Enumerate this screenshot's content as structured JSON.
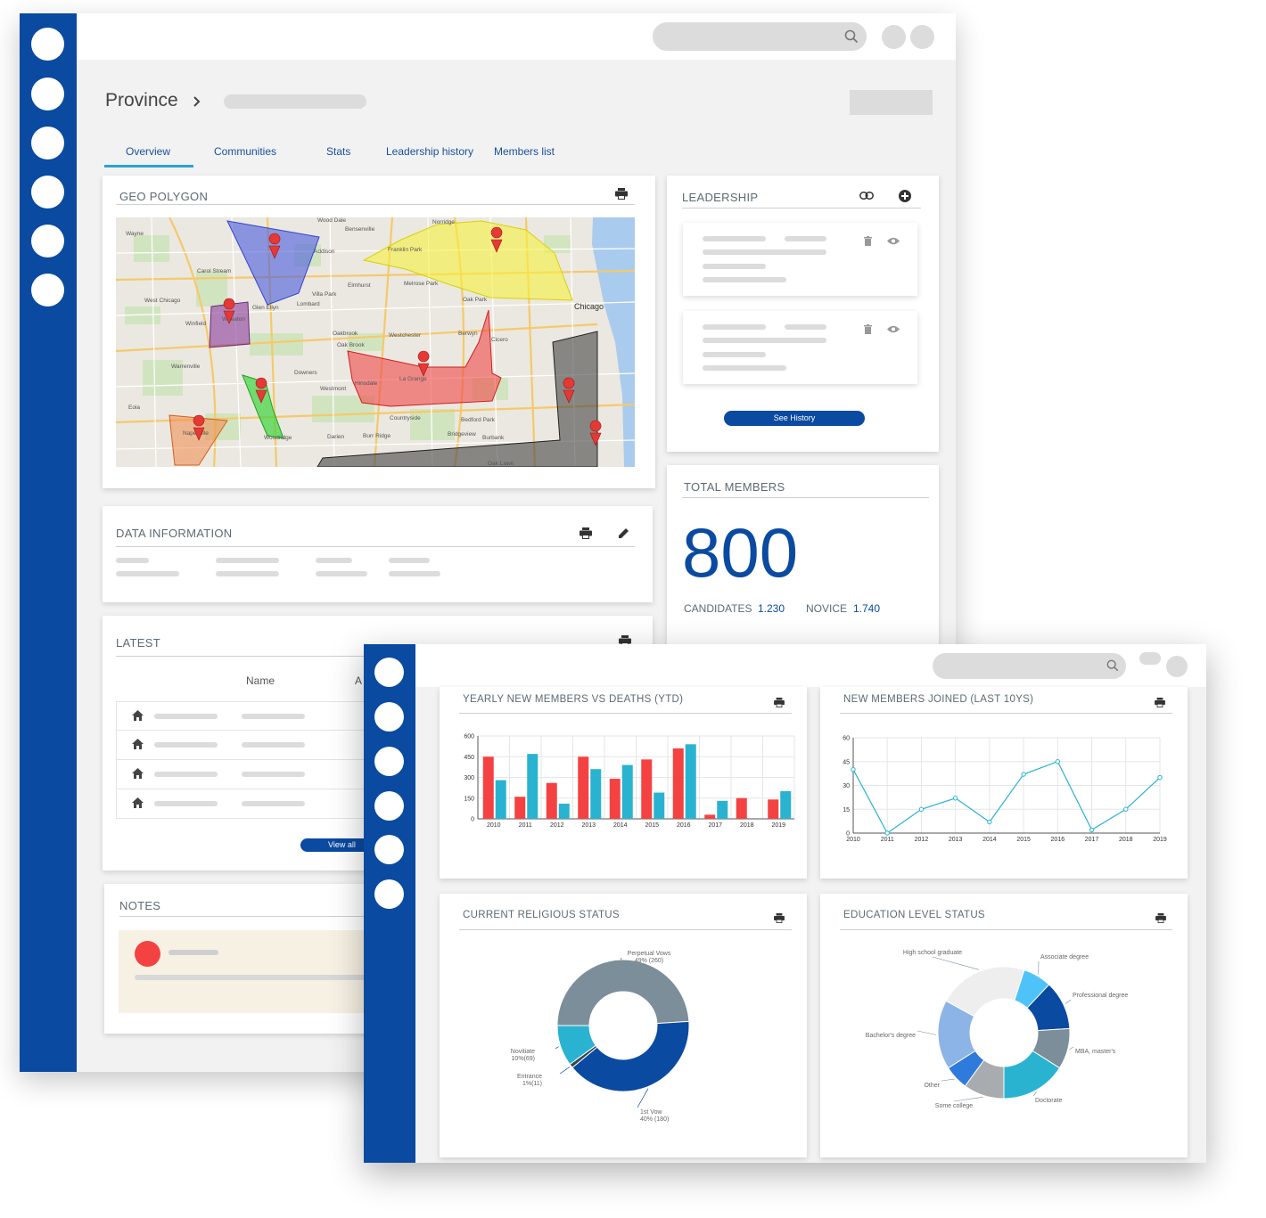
{
  "back_window": {
    "header": {
      "page_title": "Province"
    },
    "tabs": [
      "Overview",
      "Communities",
      "Stats",
      "Leadership history",
      "Members list"
    ],
    "geo_polygon": {
      "title": "GEO POLYGON",
      "map_labels": [
        "Wood Dale",
        "Bensenville",
        "Norridge",
        "Wayne",
        "Addison",
        "Franklin Park",
        "Carol Stream",
        "Elmhurst",
        "Melrose Park",
        "Villa Park",
        "Oak Park",
        "Chicago",
        "West Chicago",
        "Glen Ellyn",
        "Lombard",
        "Winfield",
        "Wheaton",
        "Oakbrook Terrace",
        "Oak Brook",
        "Westchester",
        "Berwyn",
        "Cicero",
        "Warrenville",
        "Downers Grove",
        "Hinsdale",
        "La Grange",
        "Westmont",
        "Eola",
        "Countryside",
        "Bedford Park",
        "Naperville",
        "Woodridge",
        "Darien",
        "Burr Ridge",
        "Bridgeview",
        "Burbank",
        "Oak Lawn"
      ]
    },
    "data_information": {
      "title": "DATA INFORMATION"
    },
    "latest": {
      "title": "LATEST",
      "column_name": "Name",
      "column_a": "A",
      "view_all": "View all"
    },
    "notes": {
      "title": "NOTES"
    },
    "leadership": {
      "title": "LEADERSHIP",
      "see_history": "See History"
    },
    "total_members": {
      "title": "TOTAL MEMBERS",
      "value": "800",
      "candidates_label": "CANDIDATES",
      "candidates_value": "1.230",
      "novice_label": "NOVICE",
      "novice_value": "1.740"
    }
  },
  "front_window": {
    "yearly_chart": {
      "title": "YEARLY NEW MEMBERS VS DEATHS (YTD)"
    },
    "joined_chart": {
      "title": "NEW MEMBERS JOINED (LAST 10YS)"
    },
    "religious_chart": {
      "title": "CURRENT RELIGIOUS STATUS"
    },
    "education_chart": {
      "title": "EDUCATION LEVEL STATUS"
    }
  },
  "colors": {
    "brand_blue": "#0a4aa1",
    "red": "#f44242",
    "teal": "#29b3d1",
    "slate": "#7b8e99"
  },
  "chart_data": [
    {
      "type": "bar",
      "title": "YEARLY NEW MEMBERS VS DEATHS (YTD)",
      "categories": [
        "2010",
        "2011",
        "2012",
        "2013",
        "2014",
        "2015",
        "2016",
        "2017",
        "2018",
        "2019"
      ],
      "ylim": [
        0,
        600
      ],
      "yticks": [
        0,
        150,
        300,
        450,
        600
      ],
      "series": [
        {
          "values": [
            450,
            160,
            260,
            450,
            290,
            430,
            510,
            30,
            150,
            140
          ]
        },
        {
          "values": [
            280,
            470,
            110,
            360,
            390,
            190,
            540,
            130,
            0,
            200
          ]
        }
      ]
    },
    {
      "type": "line",
      "title": "NEW MEMBERS JOINED (LAST 10YS)",
      "categories": [
        "2010",
        "2011",
        "2012",
        "2013",
        "2014",
        "2015",
        "2016",
        "2017",
        "2018",
        "2019"
      ],
      "ylim": [
        0,
        60
      ],
      "yticks": [
        0,
        15,
        30,
        45,
        60
      ],
      "values": [
        40,
        0,
        15,
        22,
        7,
        37,
        45,
        2,
        15,
        35
      ]
    },
    {
      "type": "pie",
      "title": "CURRENT RELIGIOUS STATUS",
      "slices": [
        {
          "label": "Perpetual Vows",
          "value_text": "49% (260)",
          "value": 49
        },
        {
          "label": "1st Vow",
          "value_text": "40% (180)",
          "value": 40
        },
        {
          "label": "Entrance",
          "value_text": "1%(11)",
          "value": 1
        },
        {
          "label": "Novitiate",
          "value_text": "10%(69)",
          "value": 10
        }
      ]
    },
    {
      "type": "pie",
      "title": "EDUCATION LEVEL STATUS",
      "slices": [
        {
          "label": "Associate degree",
          "value": 7
        },
        {
          "label": "Professional degree",
          "value": 12
        },
        {
          "label": "MBA, master's",
          "value": 10
        },
        {
          "label": "Doctorate",
          "value": 16
        },
        {
          "label": "Some college",
          "value": 10
        },
        {
          "label": "Other",
          "value": 6
        },
        {
          "label": "Bachelor's degree",
          "value": 17
        },
        {
          "label": "High school graduate",
          "value": 22
        }
      ]
    }
  ]
}
